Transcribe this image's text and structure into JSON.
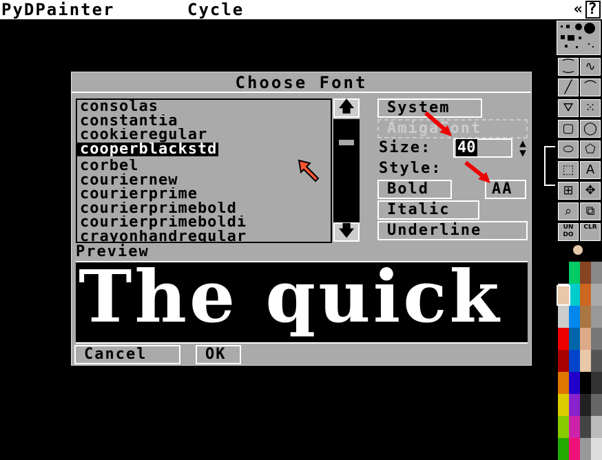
{
  "menubar": {
    "app": "PyDPainter",
    "menu_cycle": "Cycle",
    "right_glyphs": "«",
    "help_glyph": "?"
  },
  "dialog": {
    "title": "Choose Font",
    "fonts": [
      "consolas",
      "constantia",
      "cookieregular",
      "cooperblackstd",
      "corbel",
      "couriernew",
      "courierprime",
      "courierprimebold",
      "courierprimeboldi",
      "crayonhandregular"
    ],
    "selected_font": "cooperblackstd",
    "scroll_up": "🡅",
    "scroll_down": "🡇",
    "system_button": "System",
    "amigafont_button": "AmigaFont",
    "size_label": "Size:",
    "size_value": "40",
    "spinner_up": "▲",
    "spinner_down": "▼",
    "style_label": "Style:",
    "bold_button": "Bold",
    "aa_button": "AA",
    "italic_button": "Italic",
    "underline_button": "Underline",
    "preview_label": "Preview",
    "preview_text": "The quick l",
    "cancel_button": "Cancel",
    "ok_button": "OK"
  },
  "toolbox": {
    "tools": [
      {
        "name": "dotted-freehand",
        "glyph": "⁐"
      },
      {
        "name": "continuous-freehand",
        "glyph": "∿"
      },
      {
        "name": "line",
        "glyph": "╱"
      },
      {
        "name": "curve",
        "glyph": "⌒"
      },
      {
        "name": "fill",
        "glyph": "⛛"
      },
      {
        "name": "airbrush",
        "glyph": "⁙"
      },
      {
        "name": "rectangle",
        "glyph": "▢"
      },
      {
        "name": "circle",
        "glyph": "◯"
      },
      {
        "name": "ellipse",
        "glyph": "⬭"
      },
      {
        "name": "polygon",
        "glyph": "⬠"
      },
      {
        "name": "brush-select",
        "glyph": "⬚"
      },
      {
        "name": "text",
        "glyph": "A"
      },
      {
        "name": "grid",
        "glyph": "⊞"
      },
      {
        "name": "symmetry",
        "glyph": "✥"
      },
      {
        "name": "magnify",
        "glyph": "⌕"
      },
      {
        "name": "zoom",
        "glyph": "⧉"
      },
      {
        "name": "undo",
        "glyph": "UN DO"
      },
      {
        "name": "clear",
        "glyph": "CLR"
      }
    ],
    "palette": [
      "#000000",
      "#00cc66",
      "#884422",
      "#888888",
      "#ffffff",
      "#00cccc",
      "#cc6622",
      "#aaaaaa",
      "#cccccc",
      "#0088ee",
      "#aa7744",
      "#999999",
      "#ee0000",
      "#0066aa",
      "#ddaa88",
      "#777777",
      "#aa0000",
      "#0044cc",
      "#e8c8a8",
      "#555555",
      "#dd7700",
      "#2200cc",
      "#000000",
      "#333333",
      "#ddcc00",
      "#8822cc",
      "#222222",
      "#666666",
      "#88cc00",
      "#cc22aa",
      "#444444",
      "#bbbbbb",
      "#22aa00",
      "#ee1177",
      "#999999",
      "#dddddd"
    ]
  }
}
